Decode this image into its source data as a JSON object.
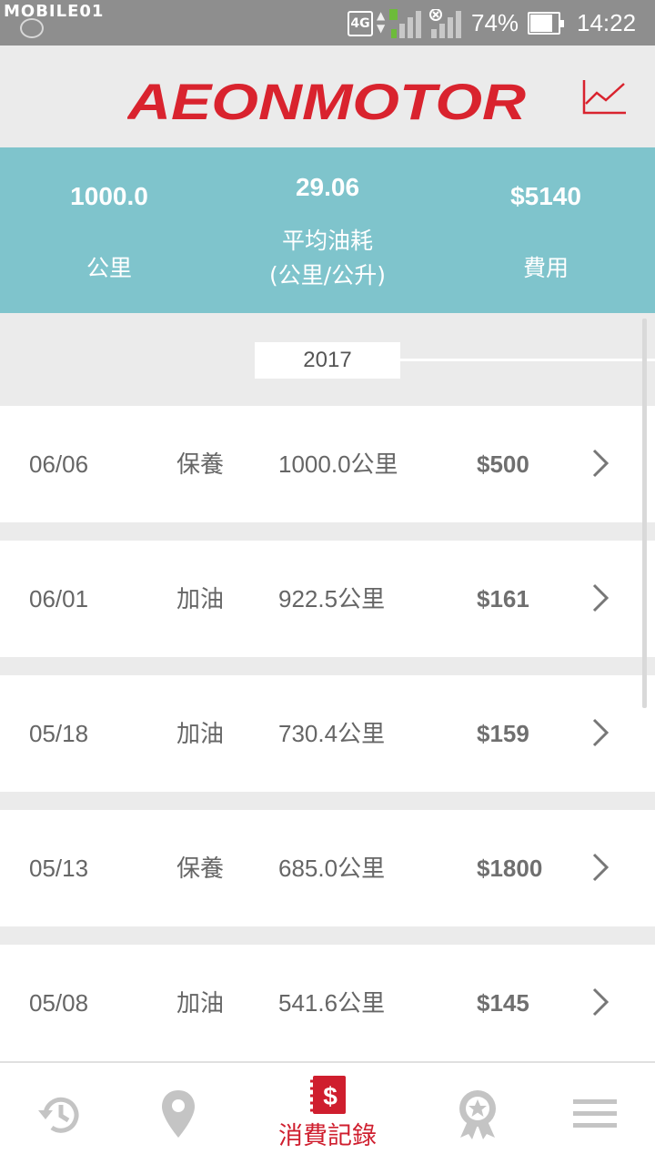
{
  "status_bar": {
    "watermark": "MOBILE01",
    "network": "4G",
    "battery_pct": "74%",
    "battery_level": 0.74,
    "time": "14:22"
  },
  "header": {
    "logo": "AEONMOTOR",
    "brand_color": "#d9232e"
  },
  "summary": {
    "distance_value": "1000.0",
    "distance_label": "公里",
    "avg_value": "29.06",
    "avg_label_line1": "平均油耗",
    "avg_label_line2": "(公里/公升)",
    "cost_value": "$5140",
    "cost_label": "費用"
  },
  "year": "2017",
  "records": [
    {
      "date": "06/06",
      "type": "保養",
      "km": "1000.0公里",
      "cost": "$500"
    },
    {
      "date": "06/01",
      "type": "加油",
      "km": "922.5公里",
      "cost": "$161"
    },
    {
      "date": "05/18",
      "type": "加油",
      "km": "730.4公里",
      "cost": "$159"
    },
    {
      "date": "05/13",
      "type": "保養",
      "km": "685.0公里",
      "cost": "$1800"
    },
    {
      "date": "05/08",
      "type": "加油",
      "km": "541.6公里",
      "cost": "$145"
    }
  ],
  "nav": {
    "active_label": "消費記錄",
    "items": [
      "history-icon",
      "location-pin-icon",
      "expense-record-icon",
      "award-badge-icon",
      "menu-icon"
    ],
    "active_color": "#cf1e2e",
    "inactive_color": "#c4c4c4"
  }
}
